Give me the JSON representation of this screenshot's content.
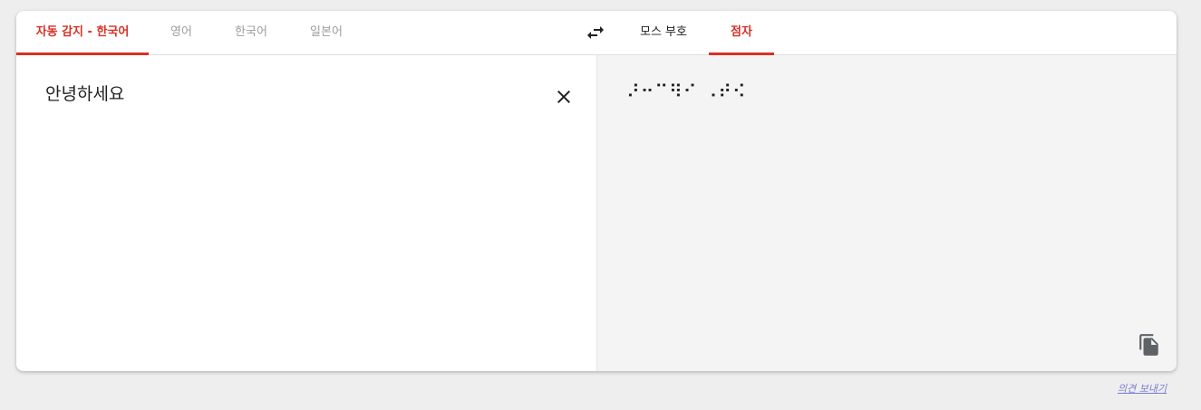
{
  "tabs": {
    "source": [
      {
        "label": "자동 감지 - 한국어",
        "active": true
      },
      {
        "label": "영어",
        "active": false
      },
      {
        "label": "한국어",
        "active": false
      },
      {
        "label": "일본어",
        "active": false
      }
    ],
    "target": [
      {
        "label": "모스 부호",
        "active": false
      },
      {
        "label": "점자",
        "active": true
      }
    ]
  },
  "source": {
    "text": "안녕하세요"
  },
  "result": {
    "text": "⠜⠒⠉⠻⠊ ⠠⠞⠪"
  },
  "icons": {
    "swap": "swap-icon",
    "clear": "close-icon",
    "copy": "copy-icon"
  },
  "footer": {
    "feedback_label": "의견 보내기"
  },
  "colors": {
    "accent": "#d93025",
    "inactive_tab": "#9e9e9e",
    "result_bg": "#f4f4f4",
    "page_bg": "#eeeeee",
    "link": "#7b7bd4"
  }
}
